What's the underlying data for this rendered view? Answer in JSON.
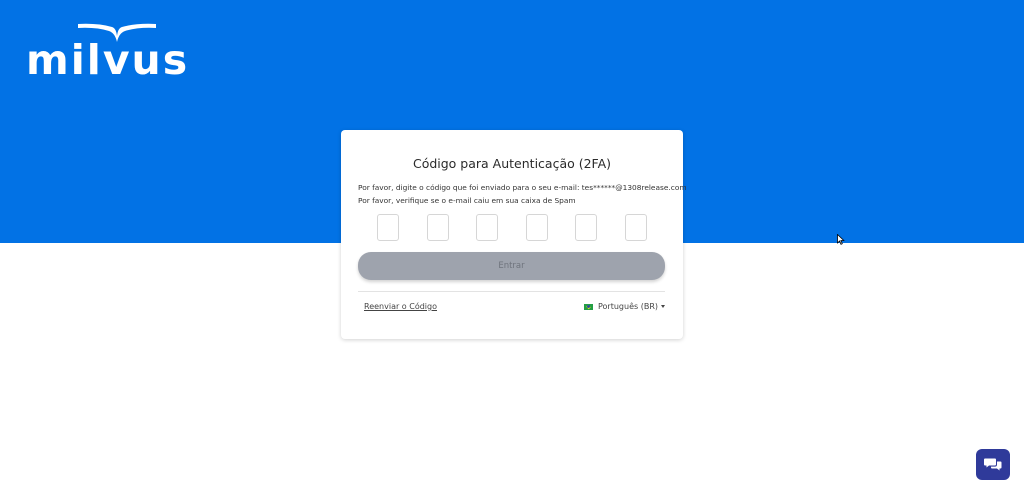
{
  "brand": {
    "logo_text": "milvus",
    "hero_color": "#0272e5"
  },
  "card": {
    "title": "Código para Autenticação (2FA)",
    "message_line1": "Por favor, digite o código que foi enviado para o seu e-mail: tes******@1308release.com",
    "message_line2": "Por favor, verifique se o e-mail caiu em sua caixa de Spam",
    "code_inputs": [
      "",
      "",
      "",
      "",
      "",
      ""
    ],
    "submit_label": "Entrar",
    "resend_label": "Reenviar o Código",
    "language": {
      "selected": "Português (BR)",
      "flag_icon": "brazil-flag-icon"
    }
  },
  "widgets": {
    "chat_icon": "chat-bubbles-icon",
    "chat_color": "#2f3a9a"
  }
}
